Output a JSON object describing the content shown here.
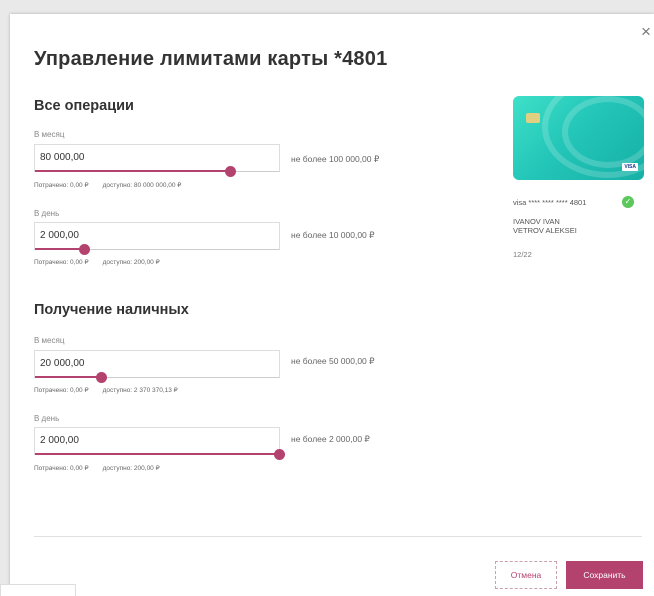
{
  "dialog": {
    "title": "Управление лимитами карты *4801",
    "close_icon": "×"
  },
  "sections": [
    {
      "title": "Все операции",
      "fields": [
        {
          "label": "В месяц",
          "value": "80 000,00",
          "limit_note": "не более 100 000,00 ₽",
          "spent": "Потрачено: 0,00 ₽",
          "available": "доступно: 80 000 000,00 ₽",
          "slider_fraction": 0.8
        },
        {
          "label": "В день",
          "value": "2 000,00",
          "limit_note": "не более 10 000,00 ₽",
          "spent": "Потрачено: 0,00 ₽",
          "available": "доступно: 200,00 ₽",
          "slider_fraction": 0.2
        }
      ]
    },
    {
      "title": "Получение наличных",
      "fields": [
        {
          "label": "В месяц",
          "value": "20 000,00",
          "limit_note": "не более 50 000,00 ₽",
          "spent": "Потрачено: 0,00 ₽",
          "available": "доступно: 2 370 370,13 ₽",
          "slider_fraction": 0.27
        },
        {
          "label": "В день",
          "value": "2 000,00",
          "limit_note": "не более 2 000,00 ₽",
          "spent": "Потрачено: 0,00 ₽",
          "available": "доступно: 200,00 ₽",
          "slider_fraction": 1.0
        }
      ]
    }
  ],
  "card": {
    "brand": "VISA",
    "number": "visa **** **** **** 4801",
    "holder_line1": "IVANOV IVAN",
    "holder_line2": "VETROV ALEKSEI",
    "expiry": "12/22",
    "status_icon": "check-circle-icon",
    "status_glyph": "✓"
  },
  "buttons": {
    "cancel": "Отмена",
    "save": "Сохранить"
  },
  "colors": {
    "accent": "#b3426e",
    "card_gradient_start": "#3fe0c8",
    "card_gradient_end": "#16b0a6",
    "status_ok": "#5cc85c"
  }
}
